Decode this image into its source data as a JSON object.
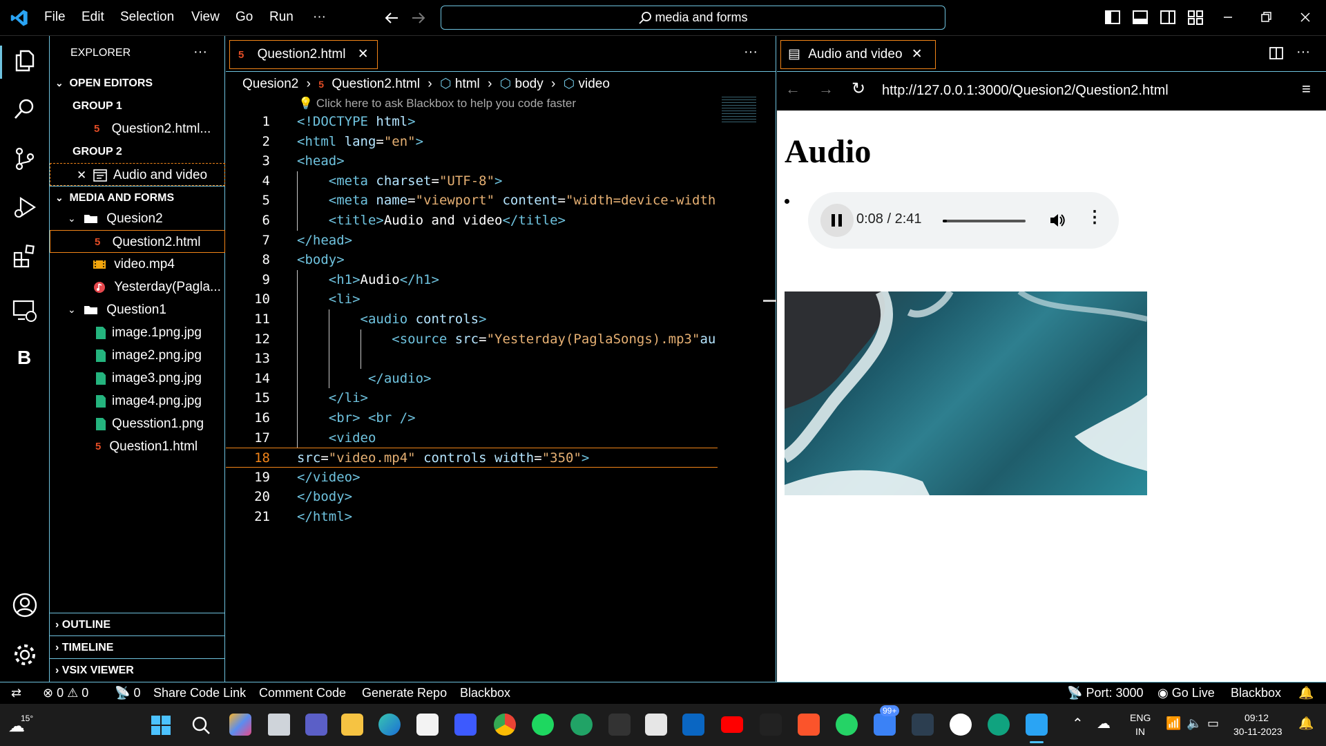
{
  "menu": {
    "file": "File",
    "edit": "Edit",
    "selection": "Selection",
    "view": "View",
    "go": "Go",
    "run": "Run",
    "more": "···"
  },
  "search": {
    "text": "media and forms"
  },
  "sidebar": {
    "title": "EXPLORER",
    "more": "···",
    "open_editors": "OPEN EDITORS",
    "group1": "GROUP 1",
    "group1_file": "Question2.html...",
    "group2": "GROUP 2",
    "group2_file": "Audio and video",
    "project": "MEDIA AND FORMS",
    "folder1": "Quesion2",
    "f1_items": [
      "Question2.html",
      "video.mp4",
      "Yesterday(Pagla..."
    ],
    "folder2": "Question1",
    "f2_items": [
      "image.1png.jpg",
      "image2.png.jpg",
      "image3.png.jpg",
      "image4.png.jpg",
      "Quesstion1.png",
      "Question1.html"
    ],
    "outline": "OUTLINE",
    "timeline": "TIMELINE",
    "vsix": "VSIX VIEWER"
  },
  "editor": {
    "tab": "Question2.html",
    "more": "···",
    "breadcrumb": [
      "Quesion2",
      "Question2.html",
      "html",
      "body",
      "video"
    ],
    "hint": "Click here to ask Blackbox to help you code faster",
    "active_line": "18"
  },
  "preview": {
    "tab": "Audio and video",
    "url": "http://127.0.0.1:3000/Quesion2/Question2.html",
    "heading": "Audio",
    "audio_time": "0:08 / 2:41",
    "audio_progress": 0.05
  },
  "status": {
    "errors": "0",
    "warnings": "0",
    "ports_count": "0",
    "share": "Share Code Link",
    "comment": "Comment Code",
    "generate": "Generate Repo",
    "blackbox": "Blackbox",
    "port": "Port: 3000",
    "golive": "Go Live",
    "blackbox_right": "Blackbox"
  },
  "taskbar": {
    "weather": "15°",
    "badge": "99+",
    "lang1": "ENG",
    "lang2": "IN",
    "time": "09:12",
    "date": "30-11-2023"
  },
  "colors": {
    "accent": "#6fc3df",
    "tag": "#6fc3df",
    "attr": "#b5e5ff",
    "string": "#e6b073",
    "html_icon": "#e44d26",
    "active_border": "#f38518"
  }
}
